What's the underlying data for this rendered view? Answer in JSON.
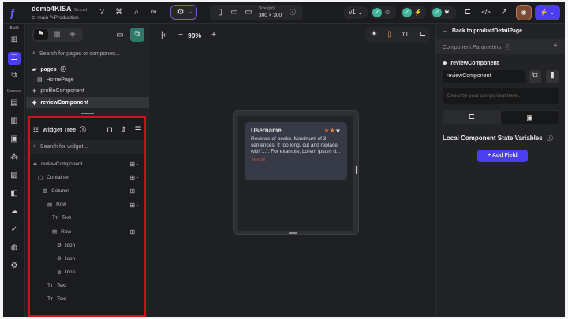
{
  "header": {
    "project": "demo4KISA",
    "sync_status": "Synced",
    "branch": "main",
    "environment": "Production",
    "size_label": "Size (px)",
    "size_value": "300 × 300",
    "version": "v1"
  },
  "rail": {
    "build_label": "Build",
    "connect_label": "Connect"
  },
  "left_panel": {
    "search_placeholder": "Search for pages or componen...",
    "pages_label": "pages",
    "pages": [
      "HomePage",
      "profileComponent",
      "reviewComponent"
    ]
  },
  "widget_tree": {
    "title": "Widget Tree",
    "search_placeholder": "Search for widget...",
    "nodes": [
      {
        "label": "reviewComponent",
        "depth": 0,
        "icon": "component-icon",
        "actions": true
      },
      {
        "label": "Container",
        "depth": 1,
        "icon": "container-icon",
        "actions": true
      },
      {
        "label": "Column",
        "depth": 2,
        "icon": "column-icon",
        "actions": true
      },
      {
        "label": "Row",
        "depth": 3,
        "icon": "row-icon",
        "actions": true
      },
      {
        "label": "Text",
        "depth": 4,
        "icon": "text-icon",
        "actions": false
      },
      {
        "label": "Row",
        "depth": 4,
        "icon": "row-icon",
        "actions": true
      },
      {
        "label": "Icon",
        "depth": 5,
        "icon": "gear-icon",
        "actions": false
      },
      {
        "label": "Icon",
        "depth": 5,
        "icon": "gear-icon",
        "actions": false
      },
      {
        "label": "Icon",
        "depth": 5,
        "icon": "gear-icon",
        "actions": false
      },
      {
        "label": "Text",
        "depth": 3,
        "icon": "text-icon",
        "actions": false
      },
      {
        "label": "Text",
        "depth": 3,
        "icon": "text-icon",
        "actions": false
      }
    ]
  },
  "canvas": {
    "zoom": "90%",
    "card": {
      "username": "Username",
      "rating": 2,
      "max_rating": 3,
      "body": "Reviews of books. Maximum of 3 sentences. If too long, cut and replace with\"...\". For example, Lorem ipsum d...",
      "link": "See all"
    }
  },
  "right_panel": {
    "back_label": "Back to productDetailPage",
    "params_title": "Component Parameters",
    "component_name_label": "reviewComponent",
    "component_name_value": "reviewComponent",
    "description_placeholder": "Describe your component here...",
    "state_title": "Local Component State Variables",
    "add_field": "Add Field"
  },
  "colors": {
    "accent": "#5b4bf5",
    "star_active_1": "#e0503a",
    "star_active_2": "#e8893a",
    "highlight": "#d0101a"
  }
}
